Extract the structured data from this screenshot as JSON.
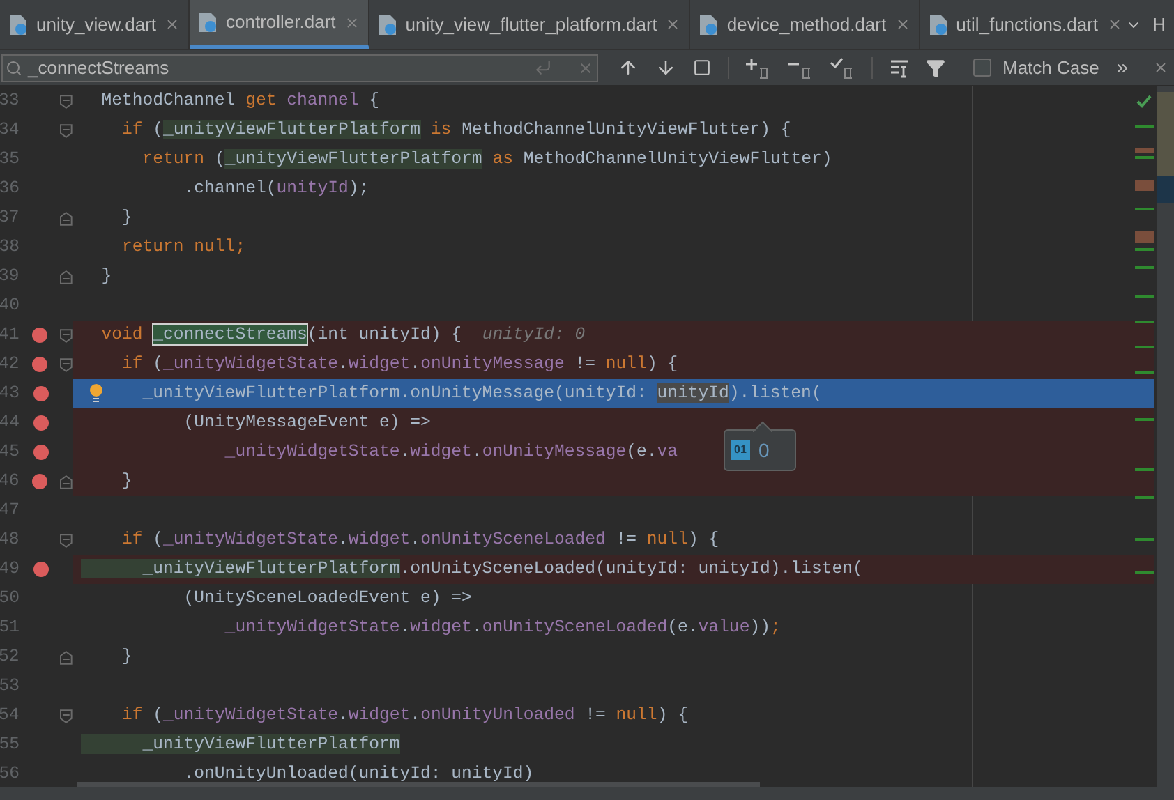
{
  "tabs": [
    {
      "label": "unity_view.dart",
      "selected": false
    },
    {
      "label": "controller.dart",
      "selected": true
    },
    {
      "label": "unity_view_flutter_platform.dart",
      "selected": false
    },
    {
      "label": "device_method.dart",
      "selected": false
    },
    {
      "label": "util_functions.dart",
      "selected": false
    }
  ],
  "side_panel_label": "H",
  "search": {
    "value": "_connectStreams",
    "match_case": {
      "label": "Match Case",
      "checked": false
    }
  },
  "editor": {
    "lines": [
      {
        "number": "33",
        "breakpoint": false,
        "current": false,
        "bulb": false,
        "fold_start": true,
        "fold_end": false,
        "segments": [
          {
            "text": "  MethodChannel ",
            "kind": "plain"
          },
          {
            "text": "get ",
            "kind": "kw"
          },
          {
            "text": "channel",
            "kind": "field"
          },
          {
            "text": " {",
            "kind": "plain"
          }
        ]
      },
      {
        "number": "34",
        "breakpoint": false,
        "current": false,
        "bulb": false,
        "fold_start": true,
        "fold_end": false,
        "segments": [
          {
            "text": "    if ",
            "kind": "kw"
          },
          {
            "text": "(",
            "kind": "plain"
          },
          {
            "text": "_unityViewFlutterPlatform",
            "kind": "usage"
          },
          {
            "text": " is ",
            "kind": "kw"
          },
          {
            "text": "MethodChannelUnityViewFlutter) {",
            "kind": "plain"
          }
        ]
      },
      {
        "number": "35",
        "breakpoint": false,
        "current": false,
        "bulb": false,
        "fold_start": false,
        "fold_end": false,
        "segments": [
          {
            "text": "      return ",
            "kind": "kw"
          },
          {
            "text": "(",
            "kind": "plain"
          },
          {
            "text": "_unityViewFlutterPlatform",
            "kind": "usage"
          },
          {
            "text": " as ",
            "kind": "kw"
          },
          {
            "text": "MethodChannelUnityViewFlutter)",
            "kind": "plain"
          }
        ]
      },
      {
        "number": "36",
        "breakpoint": false,
        "current": false,
        "bulb": false,
        "fold_start": false,
        "fold_end": false,
        "segments": [
          {
            "text": "          .channel(",
            "kind": "plain"
          },
          {
            "text": "unityId",
            "kind": "field"
          },
          {
            "text": ");",
            "kind": "plain"
          }
        ]
      },
      {
        "number": "37",
        "breakpoint": false,
        "current": false,
        "bulb": false,
        "fold_start": false,
        "fold_end": true,
        "segments": [
          {
            "text": "    }",
            "kind": "plain"
          }
        ]
      },
      {
        "number": "38",
        "breakpoint": false,
        "current": false,
        "bulb": false,
        "fold_start": false,
        "fold_end": false,
        "segments": [
          {
            "text": "    return null;",
            "kind": "kw"
          }
        ]
      },
      {
        "number": "39",
        "breakpoint": false,
        "current": false,
        "bulb": false,
        "fold_start": false,
        "fold_end": true,
        "segments": [
          {
            "text": "  }",
            "kind": "plain"
          }
        ]
      },
      {
        "number": "40",
        "breakpoint": false,
        "current": false,
        "bulb": false,
        "fold_start": false,
        "fold_end": false
      },
      {
        "number": "41",
        "breakpoint": true,
        "current": false,
        "bulb": false,
        "fold_start": true,
        "fold_end": false,
        "segments": [
          {
            "text": "  void ",
            "kind": "kw"
          },
          {
            "text": "_connectStreams",
            "kind": "match"
          },
          {
            "text": "(int unityId) {  ",
            "kind": "plain"
          },
          {
            "text": "unityId: 0",
            "kind": "hint"
          }
        ]
      },
      {
        "number": "42",
        "breakpoint": true,
        "current": false,
        "bulb": false,
        "fold_start": true,
        "fold_end": false,
        "segments": [
          {
            "text": "    if ",
            "kind": "kw"
          },
          {
            "text": "(",
            "kind": "plain"
          },
          {
            "text": "_unityWidgetState",
            "kind": "field"
          },
          {
            "text": ".",
            "kind": "plain"
          },
          {
            "text": "widget",
            "kind": "field"
          },
          {
            "text": ".",
            "kind": "plain"
          },
          {
            "text": "onUnityMessage",
            "kind": "field"
          },
          {
            "text": " != ",
            "kind": "plain"
          },
          {
            "text": "null",
            "kind": "kw"
          },
          {
            "text": ") {",
            "kind": "plain"
          }
        ]
      },
      {
        "number": "43",
        "breakpoint": true,
        "current": true,
        "bulb": true,
        "fold_start": false,
        "fold_end": false,
        "segments": [
          {
            "text": "      _unityViewFlutterPlatform.onUnityMessage(unityId: ",
            "kind": "plain"
          },
          {
            "text": "unityId",
            "kind": "selected"
          },
          {
            "text": ").listen(",
            "kind": "plain"
          }
        ]
      },
      {
        "number": "44",
        "breakpoint": true,
        "current": false,
        "bulb": false,
        "fold_start": false,
        "fold_end": false,
        "segments": [
          {
            "text": "          (UnityMessageEvent e) =>",
            "kind": "plain"
          }
        ]
      },
      {
        "number": "45",
        "breakpoint": true,
        "current": false,
        "bulb": false,
        "fold_start": false,
        "fold_end": false,
        "segments": [
          {
            "text": "              _unityWidgetState",
            "kind": "field"
          },
          {
            "text": ".",
            "kind": "plain"
          },
          {
            "text": "widget",
            "kind": "field"
          },
          {
            "text": ".",
            "kind": "plain"
          },
          {
            "text": "onUnityMessage",
            "kind": "field"
          },
          {
            "text": "(e.",
            "kind": "plain"
          },
          {
            "text": "va",
            "kind": "field"
          }
        ]
      },
      {
        "number": "46",
        "breakpoint": true,
        "current": false,
        "bulb": false,
        "fold_start": false,
        "fold_end": true,
        "segments": [
          {
            "text": "    }",
            "kind": "plain"
          }
        ]
      },
      {
        "number": "47",
        "breakpoint": false,
        "current": false,
        "bulb": false,
        "fold_start": false,
        "fold_end": false
      },
      {
        "number": "48",
        "breakpoint": false,
        "current": false,
        "bulb": false,
        "fold_start": true,
        "fold_end": false,
        "segments": [
          {
            "text": "    if ",
            "kind": "kw"
          },
          {
            "text": "(",
            "kind": "plain"
          },
          {
            "text": "_unityWidgetState",
            "kind": "field"
          },
          {
            "text": ".",
            "kind": "plain"
          },
          {
            "text": "widget",
            "kind": "field"
          },
          {
            "text": ".",
            "kind": "plain"
          },
          {
            "text": "onUnitySceneLoaded",
            "kind": "field"
          },
          {
            "text": " != ",
            "kind": "plain"
          },
          {
            "text": "null",
            "kind": "kw"
          },
          {
            "text": ") {",
            "kind": "plain"
          }
        ]
      },
      {
        "number": "49",
        "breakpoint": true,
        "current": false,
        "bulb": false,
        "fold_start": false,
        "fold_end": false,
        "segments": [
          {
            "text": "      _unityViewFlutterPlatform",
            "kind": "usage"
          },
          {
            "text": ".onUnitySceneLoaded(unityId: unityId).listen(",
            "kind": "plain"
          }
        ]
      },
      {
        "number": "50",
        "breakpoint": false,
        "current": false,
        "bulb": false,
        "fold_start": false,
        "fold_end": false,
        "segments": [
          {
            "text": "          (UnitySceneLoadedEvent e) =>",
            "kind": "plain"
          }
        ]
      },
      {
        "number": "51",
        "breakpoint": false,
        "current": false,
        "bulb": false,
        "fold_start": false,
        "fold_end": false,
        "segments": [
          {
            "text": "              _unityWidgetState",
            "kind": "field"
          },
          {
            "text": ".",
            "kind": "plain"
          },
          {
            "text": "widget",
            "kind": "field"
          },
          {
            "text": ".",
            "kind": "plain"
          },
          {
            "text": "onUnitySceneLoaded",
            "kind": "field"
          },
          {
            "text": "(e.",
            "kind": "plain"
          },
          {
            "text": "value",
            "kind": "field"
          },
          {
            "text": "))",
            "kind": "plain"
          },
          {
            "text": ";",
            "kind": "kw"
          }
        ]
      },
      {
        "number": "52",
        "breakpoint": false,
        "current": false,
        "bulb": false,
        "fold_start": false,
        "fold_end": true,
        "segments": [
          {
            "text": "    }",
            "kind": "plain"
          }
        ]
      },
      {
        "number": "53",
        "breakpoint": false,
        "current": false,
        "bulb": false,
        "fold_start": false,
        "fold_end": false
      },
      {
        "number": "54",
        "breakpoint": false,
        "current": false,
        "bulb": false,
        "fold_start": true,
        "fold_end": false,
        "segments": [
          {
            "text": "    if ",
            "kind": "kw"
          },
          {
            "text": "(",
            "kind": "plain"
          },
          {
            "text": "_unityWidgetState",
            "kind": "field"
          },
          {
            "text": ".",
            "kind": "plain"
          },
          {
            "text": "widget",
            "kind": "field"
          },
          {
            "text": ".",
            "kind": "plain"
          },
          {
            "text": "onUnityUnloaded",
            "kind": "field"
          },
          {
            "text": " != ",
            "kind": "plain"
          },
          {
            "text": "null",
            "kind": "kw"
          },
          {
            "text": ") {",
            "kind": "plain"
          }
        ]
      },
      {
        "number": "55",
        "breakpoint": false,
        "current": false,
        "bulb": false,
        "fold_start": false,
        "fold_end": false,
        "segments": [
          {
            "text": "      _unityViewFlutterPlatform",
            "kind": "usage"
          }
        ]
      },
      {
        "number": "56",
        "breakpoint": false,
        "current": false,
        "bulb": false,
        "fold_start": false,
        "fold_end": false,
        "segments": [
          {
            "text": "          .onUnityUnloaded(unityId: unityId)",
            "kind": "plain"
          }
        ]
      }
    ],
    "value_tooltip": {
      "icon_label": "01",
      "value": "0"
    }
  }
}
